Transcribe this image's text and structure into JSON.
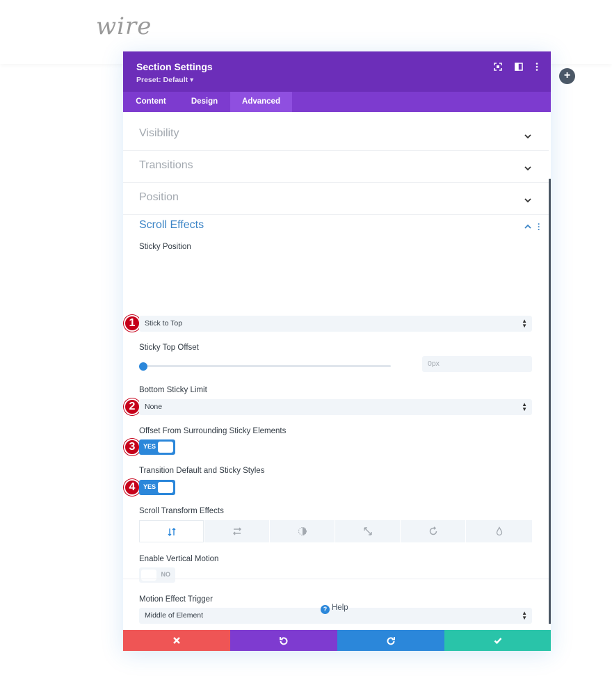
{
  "logo": {
    "text": "wire"
  },
  "modal": {
    "title": "Section Settings",
    "preset": "Preset: Default ▾",
    "header_icons": [
      "fullscreen-icon",
      "split-view-icon",
      "more-vertical-icon"
    ]
  },
  "tabs": [
    {
      "label": "Content",
      "active": false
    },
    {
      "label": "Design",
      "active": false
    },
    {
      "label": "Advanced",
      "active": true
    }
  ],
  "sections": {
    "visibility": "Visibility",
    "transitions": "Transitions",
    "position": "Position",
    "scroll_effects": "Scroll Effects"
  },
  "fields": {
    "sticky_position": {
      "label": "Sticky Position",
      "value": "Stick to Top",
      "badge": "1"
    },
    "sticky_top_offset": {
      "label": "Sticky Top Offset",
      "value": "0px",
      "slider_fraction": 0
    },
    "bottom_sticky_limit": {
      "label": "Bottom Sticky Limit",
      "value": "None",
      "badge": "2"
    },
    "offset_surrounding": {
      "label": "Offset From Surrounding Sticky Elements",
      "toggle": "YES",
      "badge": "3"
    },
    "transition_default": {
      "label": "Transition Default and Sticky Styles",
      "toggle": "YES",
      "badge": "4"
    },
    "scroll_transform": {
      "label": "Scroll Transform Effects",
      "effects": [
        "vertical-motion-icon",
        "horizontal-motion-icon",
        "fading-icon",
        "scaling-icon",
        "rotating-icon",
        "blur-icon"
      ],
      "active_index": 0
    },
    "enable_vertical_motion": {
      "label": "Enable Vertical Motion",
      "toggle": "NO"
    },
    "motion_effect_trigger": {
      "label": "Motion Effect Trigger",
      "value": "Middle of Element"
    }
  },
  "help": {
    "label": "Help"
  },
  "footer": {
    "colors": {
      "cancel": "#ef5555",
      "undo": "#7e3bd0",
      "redo": "#2b87da",
      "save": "#29c4a9"
    }
  },
  "colors": {
    "header": "#6c2eb9",
    "tabs": "#7d3bcf",
    "accent": "#2b87da",
    "badge": "#c6001a"
  }
}
